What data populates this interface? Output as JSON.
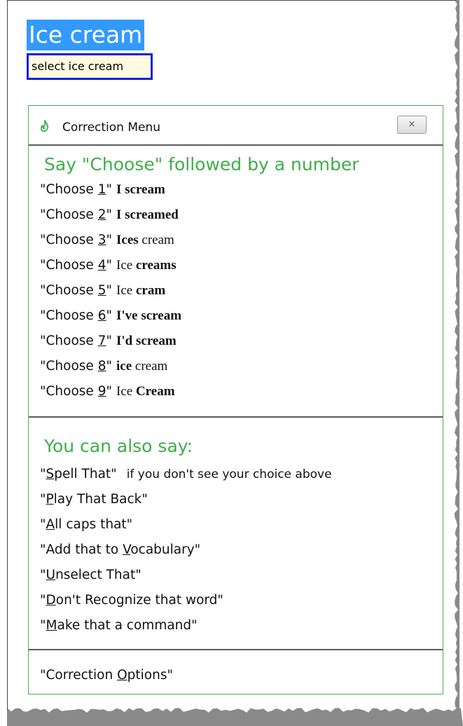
{
  "document": {
    "title": "Ice cream",
    "selection_label": "select ice cream"
  },
  "correction_menu": {
    "title": "Correction Menu",
    "close_label": "×",
    "choose_heading": "Say \"Choose\" followed by a number",
    "choose_prefix": "\"Choose ",
    "choose_suffix": "\"",
    "choices": [
      {
        "number": "1",
        "parts": [
          {
            "text": "I scream",
            "bold": true
          }
        ]
      },
      {
        "number": "2",
        "parts": [
          {
            "text": "I screamed",
            "bold": true
          }
        ]
      },
      {
        "number": "3",
        "parts": [
          {
            "text": "Ices",
            "bold": true
          },
          {
            "text": " cream",
            "bold": false
          }
        ]
      },
      {
        "number": "4",
        "parts": [
          {
            "text": "Ice ",
            "bold": false
          },
          {
            "text": "creams",
            "bold": true
          }
        ]
      },
      {
        "number": "5",
        "parts": [
          {
            "text": "Ice ",
            "bold": false
          },
          {
            "text": "cram",
            "bold": true
          }
        ]
      },
      {
        "number": "6",
        "parts": [
          {
            "text": "I've scream",
            "bold": true
          }
        ]
      },
      {
        "number": "7",
        "parts": [
          {
            "text": "I'd scream",
            "bold": true
          }
        ]
      },
      {
        "number": "8",
        "parts": [
          {
            "text": "ice",
            "bold": true
          },
          {
            "text": " cream",
            "bold": false
          }
        ]
      },
      {
        "number": "9",
        "parts": [
          {
            "text": "Ice ",
            "bold": false
          },
          {
            "text": "Cream",
            "bold": true
          }
        ]
      }
    ],
    "also_heading": "You can also say:",
    "commands": [
      {
        "before": "\"",
        "key": "S",
        "after": "pell That\"",
        "hint": "if you don't see your choice above"
      },
      {
        "before": "\"",
        "key": "P",
        "after": "lay That Back\"",
        "hint": ""
      },
      {
        "before": "\"",
        "key": "A",
        "after": "ll caps that\"",
        "hint": ""
      },
      {
        "before": "\"Add that to ",
        "key": "V",
        "after": "ocabulary\"",
        "hint": ""
      },
      {
        "before": "\"",
        "key": "U",
        "after": "nselect That\"",
        "hint": ""
      },
      {
        "before": "\"",
        "key": "D",
        "after": "on't Recognize that word\"",
        "hint": ""
      },
      {
        "before": "\"",
        "key": "M",
        "after": "ake that a command\"",
        "hint": ""
      }
    ],
    "footer": {
      "before": "\"Correction ",
      "key": "O",
      "after": "ptions\""
    },
    "accent_color": "#3fae49",
    "icons": {
      "app": "dragon-flame-icon",
      "close": "close-icon"
    }
  }
}
